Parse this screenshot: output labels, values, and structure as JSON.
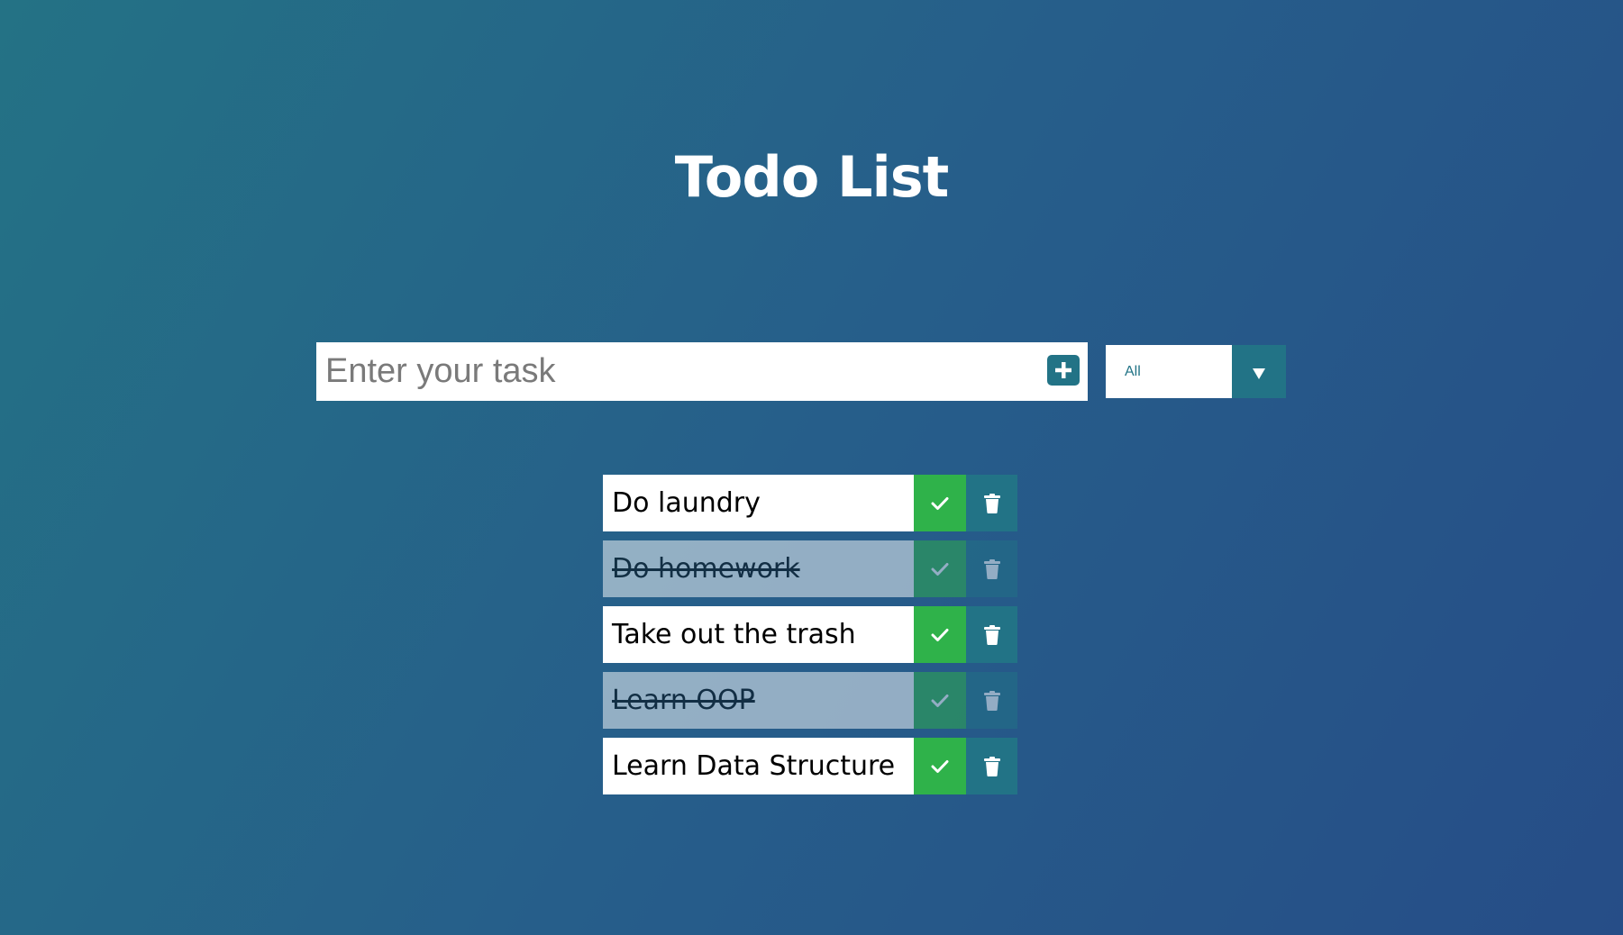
{
  "header": {
    "title": "Todo List"
  },
  "form": {
    "input_value": "",
    "input_placeholder": "Enter your task",
    "add_icon": "plus-square-icon"
  },
  "filter": {
    "selected": "All",
    "arrow_icon": "triangle-down-icon"
  },
  "todos": [
    {
      "text": "Do laundry",
      "completed": false
    },
    {
      "text": "Do homework",
      "completed": true
    },
    {
      "text": "Take out the trash",
      "completed": false
    },
    {
      "text": "Learn OOP",
      "completed": true
    },
    {
      "text": "Learn Data Structure",
      "completed": false
    }
  ],
  "icons": {
    "complete": "check-icon",
    "delete": "trash-icon"
  },
  "colors": {
    "accent": "#227386",
    "check_green": "#2fb24a",
    "bg_start": "#247285",
    "bg_end": "#264d87"
  }
}
